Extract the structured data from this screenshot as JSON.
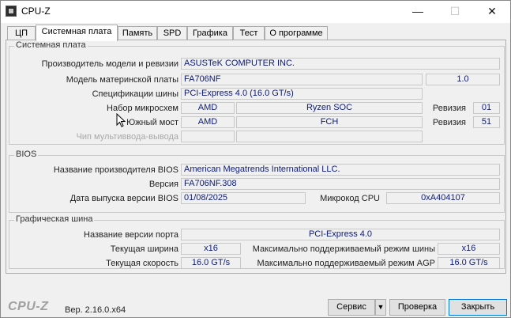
{
  "window": {
    "title": "CPU-Z",
    "minimize": "—",
    "maximize": "☐",
    "close": "✕"
  },
  "tabs": [
    {
      "label": "ЦП"
    },
    {
      "label": "Системная плата"
    },
    {
      "label": "Память"
    },
    {
      "label": "SPD"
    },
    {
      "label": "Графика"
    },
    {
      "label": "Тест"
    },
    {
      "label": "О программе"
    }
  ],
  "mainboard": {
    "group_title": "Системная плата",
    "manufacturer_label": "Производитель модели и ревизии",
    "manufacturer_value": "ASUSTeK COMPUTER INC.",
    "model_label": "Модель материнской платы",
    "model_value": "FA706NF",
    "model_revision": "1.0",
    "bus_label": "Спецификации шины",
    "bus_value": "PCI-Express 4.0 (16.0 GT/s)",
    "chipset_label": "Набор микросхем",
    "chipset_vendor": "AMD",
    "chipset_model": "Ryzen SOC",
    "chipset_rev_label": "Ревизия",
    "chipset_rev": "01",
    "southbridge_label": "Южный мост",
    "southbridge_vendor": "AMD",
    "southbridge_model": "FCH",
    "southbridge_rev_label": "Ревизия",
    "southbridge_rev": "51",
    "lpcio_label": "Чип мультиввода-вывода"
  },
  "bios": {
    "group_title": "BIOS",
    "brand_label": "Название производителя BIOS",
    "brand_value": "American Megatrends International LLC.",
    "version_label": "Версия",
    "version_value": "FA706NF.308",
    "date_label": "Дата выпуска версии BIOS",
    "date_value": "01/08/2025",
    "microcode_label": "Микрокод CPU",
    "microcode_value": "0xA404107"
  },
  "graphic_interface": {
    "group_title": "Графическая шина",
    "version_label": "Название версии порта",
    "version_value": "PCI-Express 4.0",
    "link_width_label": "Текущая ширина",
    "link_width_value": "x16",
    "max_width_label": "Максимально поддерживаемый режим шины",
    "max_width_value": "x16",
    "link_speed_label": "Текущая скорость",
    "link_speed_value": "16.0 GT/s",
    "max_speed_label": "Максимально поддерживаемый режим AGP",
    "max_speed_value": "16.0 GT/s"
  },
  "footer": {
    "logo": "CPU-Z",
    "version": "Вер. 2.16.0.x64",
    "tools_label": "Сервис",
    "tools_arrow": "▼",
    "validate_label": "Проверка",
    "close_label": "Закрыть"
  }
}
